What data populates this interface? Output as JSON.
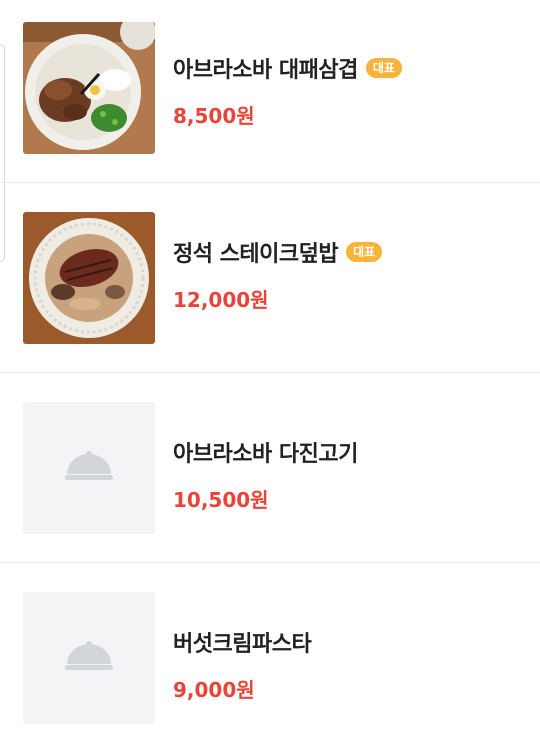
{
  "menu_items": [
    {
      "name": "아브라소바 대패삼겹",
      "badge": "대표",
      "price": "8,500원",
      "image": "dish-photo"
    },
    {
      "name": "정석 스테이크덮밥",
      "badge": "대표",
      "price": "12,000원",
      "image": "dish-photo"
    },
    {
      "name": "아브라소바 다진고기",
      "badge": "",
      "price": "10,500원",
      "image": "placeholder-cloche-icon"
    },
    {
      "name": "버섯크림파스타",
      "badge": "",
      "price": "9,000원",
      "image": "placeholder-cloche-icon"
    }
  ],
  "colors": {
    "price": "#e8443a",
    "badge": "#f7b33a",
    "placeholder_bg": "#f2f4f6"
  }
}
